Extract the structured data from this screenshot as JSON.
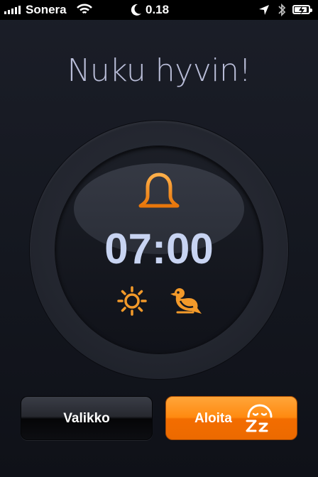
{
  "status_bar": {
    "carrier": "Sonera",
    "time": "0.18",
    "signal_bars": 5,
    "icons": [
      "signal-icon",
      "wifi-icon",
      "moon-icon",
      "location-icon",
      "bluetooth-icon",
      "battery-icon"
    ]
  },
  "title": "Nuku hyvin!",
  "alarm": {
    "time": "07:00",
    "icons": [
      "bell-icon",
      "sun-icon",
      "bird-icon"
    ],
    "accent_color": "#f08a1c"
  },
  "buttons": {
    "menu_label": "Valikko",
    "start_label": "Aloita",
    "start_icon": "sleep-zz-icon",
    "start_color": "#ff8a10"
  }
}
